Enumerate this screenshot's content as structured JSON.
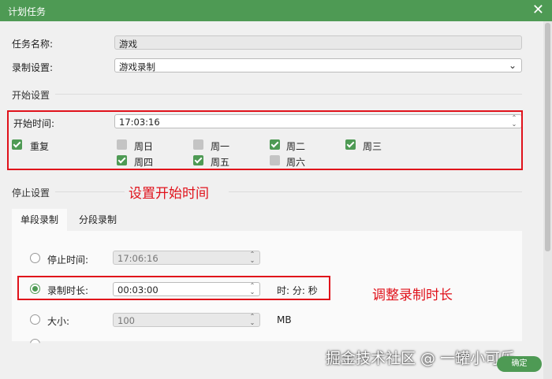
{
  "window": {
    "title": "计划任务"
  },
  "form": {
    "task_name_label": "任务名称:",
    "task_name_value": "游戏",
    "record_settings_label": "录制设置:",
    "record_settings_value": "游戏录制"
  },
  "start": {
    "section_title": "开始设置",
    "start_time_label": "开始时间:",
    "start_time_value": "17:03:16",
    "repeat_label": "重复",
    "repeat_checked": true,
    "days": [
      {
        "label": "周日",
        "checked": false
      },
      {
        "label": "周一",
        "checked": false
      },
      {
        "label": "周二",
        "checked": true
      },
      {
        "label": "周三",
        "checked": true
      },
      {
        "label": "周四",
        "checked": true
      },
      {
        "label": "周五",
        "checked": true
      },
      {
        "label": "周六",
        "checked": false
      }
    ]
  },
  "stop": {
    "section_title": "停止设置",
    "tabs": [
      {
        "label": "单段录制",
        "active": true
      },
      {
        "label": "分段录制",
        "active": false
      }
    ],
    "options": {
      "stop_time_label": "停止时间:",
      "stop_time_value": "17:06:16",
      "duration_label": "录制时长:",
      "duration_value": "00:03:00",
      "duration_unit": "时: 分: 秒",
      "size_label": "大小:",
      "size_value": "100",
      "size_unit": "MB",
      "selected": "duration"
    }
  },
  "annotations": {
    "start_note": "设置开始时间",
    "duration_note": "调整录制时长"
  },
  "watermark": "掘金技术社区 @ 一罐小可乐",
  "footer": {
    "ok_label": "确定"
  },
  "colors": {
    "accent": "#4e9a54",
    "annotation": "#e0121b"
  }
}
